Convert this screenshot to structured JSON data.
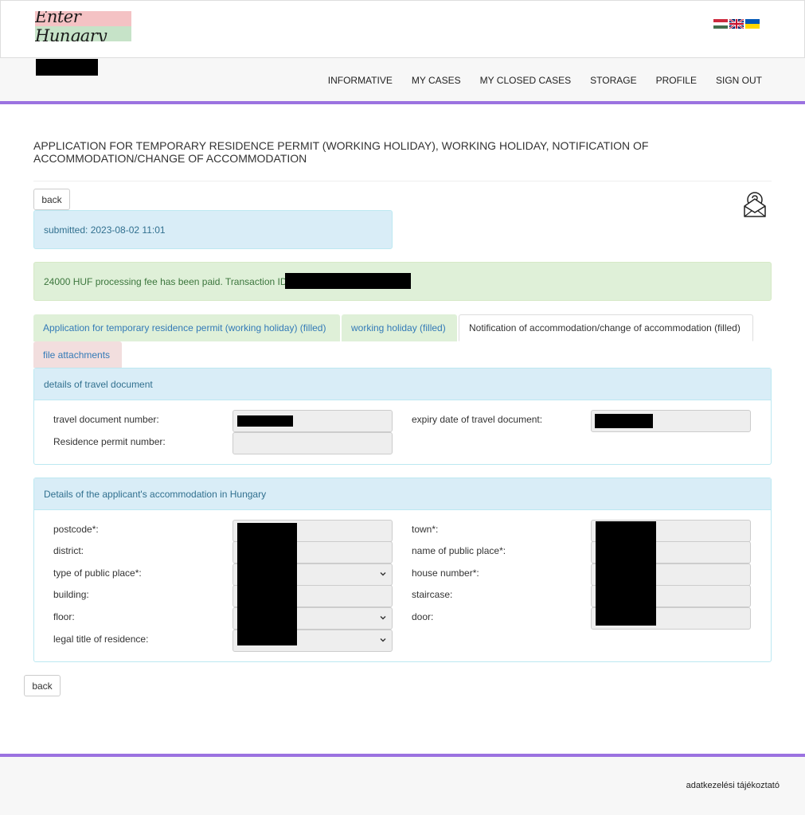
{
  "header": {
    "logo_text": "Enter Hungary",
    "flags": [
      "hungary-flag-icon",
      "uk-flag-icon",
      "ukraine-flag-icon"
    ]
  },
  "nav": {
    "items": [
      "INFORMATIVE",
      "MY CASES",
      "MY CLOSED CASES",
      "STORAGE",
      "PROFILE",
      "SIGN OUT"
    ]
  },
  "page": {
    "title": "APPLICATION FOR TEMPORARY RESIDENCE PERMIT (WORKING HOLIDAY), WORKING HOLIDAY, NOTIFICATION OF ACCOMMODATION/CHANGE OF ACCOMMODATION",
    "back_label": "back",
    "submitted_text": "submitted: 2023-08-02 11:01",
    "fee_text": "24000 HUF processing fee has been paid. Transaction ID:"
  },
  "tabs": [
    "Application for temporary residence permit (working holiday) (filled)",
    "working holiday (filled)",
    "Notification of accommodation/change of accommodation (filled)",
    "file attachments"
  ],
  "travel_document": {
    "heading": "details of travel document",
    "labels": {
      "doc_number": "travel document number:",
      "expiry": "expiry date of travel document:",
      "permit_number": "Residence permit number:"
    }
  },
  "accommodation": {
    "heading": "Details of the applicant's accommodation in Hungary",
    "left_labels": [
      "postcode*:",
      "district:",
      "type of public place*:",
      "building:",
      "floor:",
      "legal title of residence:"
    ],
    "right_labels": [
      "town*:",
      "name of public place*:",
      "house number*:",
      "staircase:",
      "door:"
    ]
  },
  "footer": {
    "link": "adatkezelési tájékoztató"
  },
  "colors": {
    "accent": "#9b72e0",
    "info_bg": "#d9edf7",
    "success_bg": "#dff0d8",
    "danger_bg": "#f2dede"
  }
}
